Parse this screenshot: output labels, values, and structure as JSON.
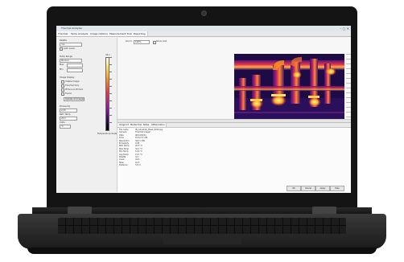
{
  "screen": {
    "title": "Thermal Analyzer",
    "window_controls": "– ▢ ✕",
    "tabs": [
      "Thermal",
      "Temp Analysis",
      "Image Options",
      "Measurement Tools",
      "Reporting"
    ],
    "left": {
      "section_palette": "Palette",
      "palette_value": "Iron",
      "palette_option": "Auto Level",
      "section_range": "Temp Range",
      "range_value": "Manual",
      "max_label": "Max",
      "min_label": "Min",
      "section_display": "Image Display",
      "options": [
        "Visible Image",
        "Thermal Only",
        "Picture-in-Picture",
        "Fusion"
      ],
      "blend_button": "Update All Images",
      "emissivity_label": "Emissivity",
      "emissivity_value": "0.95",
      "reflected_label": "Refl. Temp",
      "reflected_value": "20.0",
      "units_label": "Units",
      "units_value": "°C",
      "scale_top": "34.1",
      "scale_bottom": "Temperature Scale"
    },
    "view": {
      "zoom_label": "Zoom:",
      "zoom_value": "100%",
      "option_label": "Show Grid",
      "left_caption": "Live Preview",
      "bottom_caption": "Thermal Image",
      "corner_caption": "Ready"
    },
    "props": {
      "tabs": [
        "Image Info",
        "Marker Data",
        "Notes",
        "GPS/Location"
      ],
      "rows": [
        {
          "k": "File name",
          "v": "IR_Industrial_Pipes_0012.jpg"
        },
        {
          "k": "Camera",
          "v": "Thermal Imager"
        },
        {
          "k": "Date",
          "v": "06/14/2011"
        },
        {
          "k": "Time",
          "v": "10:42:17 AM"
        },
        {
          "k": "Resolution",
          "v": "320 x 240"
        },
        {
          "k": "Emissivity",
          "v": "0.95"
        },
        {
          "k": "Refl. Temp",
          "v": "20.0 °C"
        },
        {
          "k": "Max Temp",
          "v": "34.1 °C"
        },
        {
          "k": "Min Temp",
          "v": "12.6 °C"
        },
        {
          "k": "Avg Temp",
          "v": "21.3 °C"
        },
        {
          "k": "Palette",
          "v": "Iron"
        },
        {
          "k": "Level",
          "v": "Auto"
        },
        {
          "k": "Span",
          "v": "21.5"
        },
        {
          "k": "Distance",
          "v": "3.0 m"
        }
      ],
      "buttons": [
        "OK",
        "Cancel",
        "Apply",
        "Help"
      ]
    }
  },
  "colors": {
    "bezel": "#141414",
    "screen_bg": "#f3f3f3",
    "thermal_hot": "#ffe36b",
    "thermal_mid": "#e8334a",
    "thermal_cold": "#2a0a52"
  }
}
